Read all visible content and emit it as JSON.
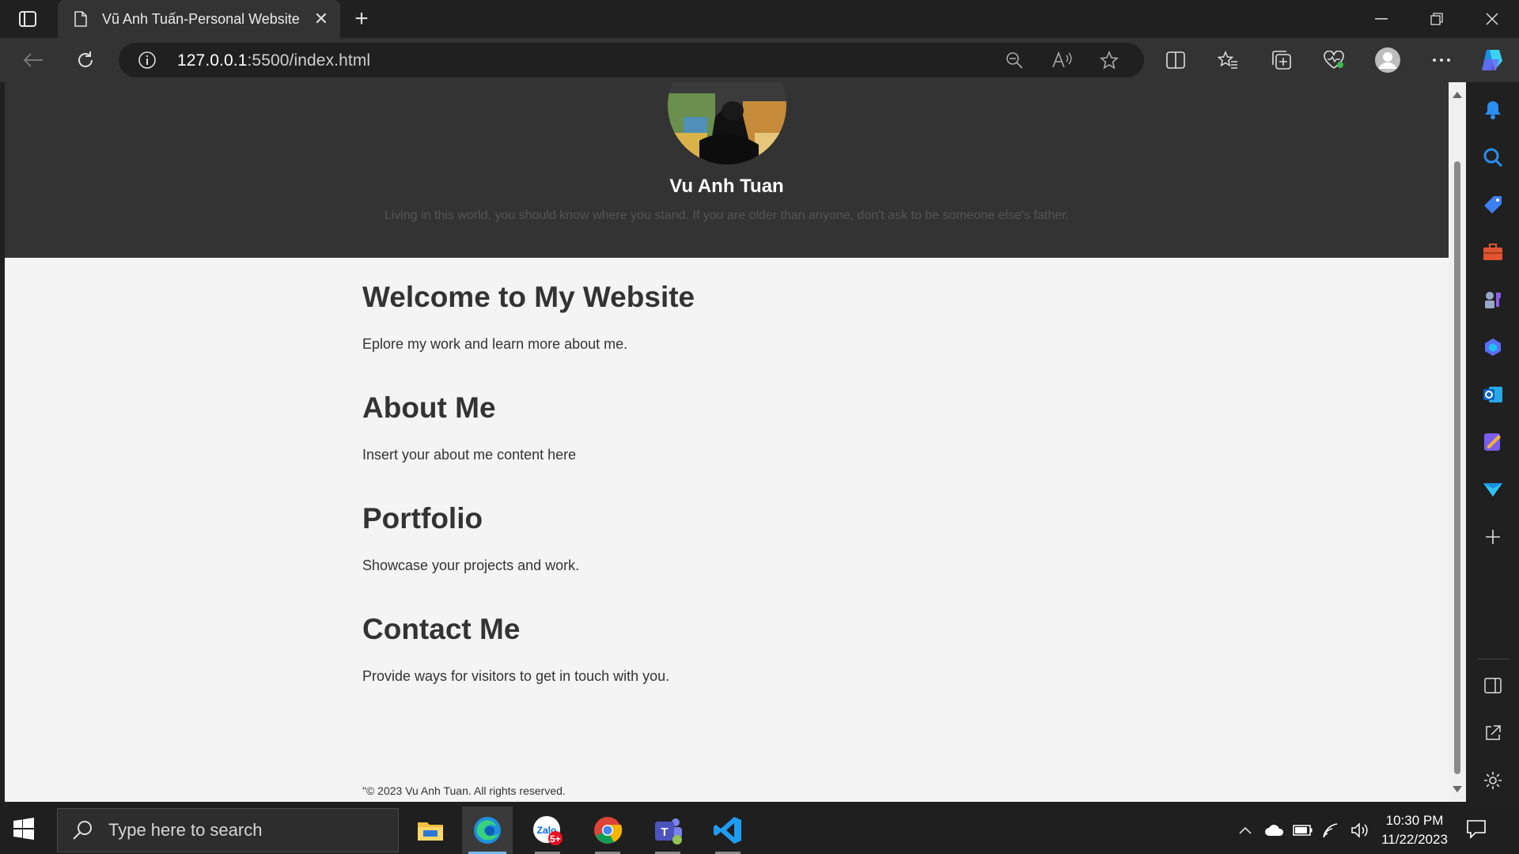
{
  "browser": {
    "tab_title": "Vũ Anh Tuấn-Personal Website",
    "url_host": "127.0.0.1",
    "url_rest": ":5500/index.html"
  },
  "site": {
    "name": "Vu Anh Tuan",
    "tagline": "Living in this world, you should know where you stand. If you are older than anyone, don't ask to be someone else's father.",
    "sections": [
      {
        "heading": "Welcome to My Website",
        "text": "Eplore my work and learn more about me."
      },
      {
        "heading": "About Me",
        "text": "Insert your about me content here"
      },
      {
        "heading": "Portfolio",
        "text": "Showcase your projects and work."
      },
      {
        "heading": "Contact Me",
        "text": "Provide ways for visitors to get in touch with you."
      }
    ],
    "footer": "\"© 2023 Vu Anh Tuan. All rights reserved."
  },
  "taskbar": {
    "search_placeholder": "Type here to search",
    "time": "10:30 PM",
    "date": "11/22/2023",
    "zalo_badge": "5+"
  },
  "colors": {
    "header_bg": "#333333",
    "page_bg": "#f4f4f4",
    "accent": "#0078d4"
  }
}
